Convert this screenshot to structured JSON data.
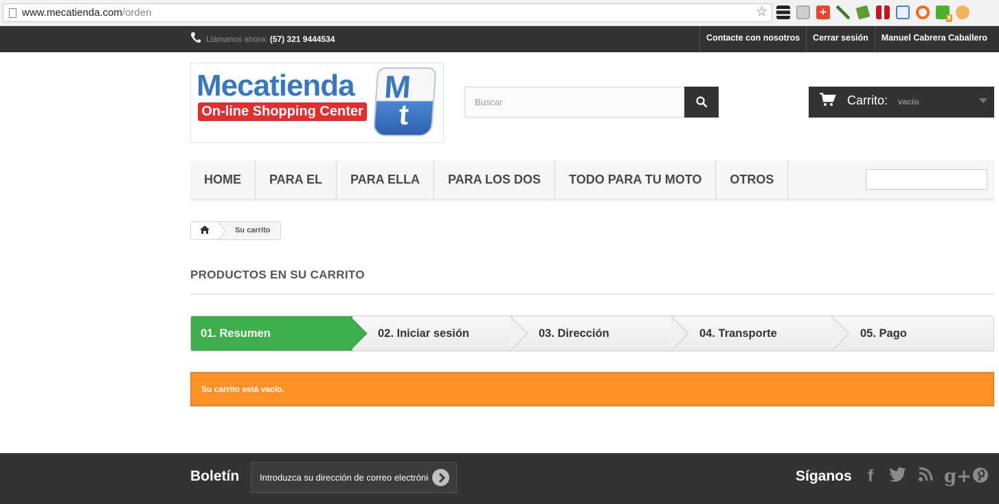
{
  "browser": {
    "url_host": "www.mecatienda.com",
    "url_path": "/orden",
    "icons": [
      "page-icon",
      "bookmark-star-icon",
      "layers-extension-icon",
      "extension-icon",
      "plus-extension-icon",
      "eyedropper-extension-icon",
      "stack-extension-icon",
      "pdf-extension-icon",
      "folder-extension-icon",
      "loop-extension-icon",
      "notification-extension-icon",
      "cookie-extension-icon"
    ],
    "notification_badge": "8"
  },
  "topbar": {
    "call_label": "Llámanos ahora: ",
    "phone": "(57) 321 9444534",
    "links": [
      "Contacte con nosotros",
      "Cerrar sesión",
      "Manuel Cabrera Caballero"
    ]
  },
  "logo": {
    "word": "Mecatienda",
    "tagline": "On-line Shopping Center",
    "mark_m": "M",
    "mark_t": "t"
  },
  "search": {
    "placeholder": "Buscar",
    "button_icon": "search-icon"
  },
  "cart": {
    "label": "Carrito:",
    "status": "vacío",
    "icon": "cart-icon"
  },
  "menu": {
    "items": [
      "HOME",
      "PARA EL",
      "PARA ELLA",
      "PARA LOS DOS",
      "TODO PARA TU MOTO",
      "OTROS"
    ]
  },
  "breadcrumb": {
    "home_icon": "home-icon",
    "current": "Su carrito"
  },
  "page": {
    "heading": "PRODUCTOS EN SU CARRITO"
  },
  "steps": [
    "01. Resumen",
    "02. Iniciar sesión",
    "03. Dirección",
    "04. Transporte",
    "05. Pago"
  ],
  "alert": {
    "message": "Su carrito está vacío."
  },
  "footer": {
    "newsletter_title": "Boletín",
    "newsletter_placeholder": "Introduzca su dirección de correo electrónico",
    "follow_title": "Síganos",
    "social": [
      "facebook-icon",
      "twitter-icon",
      "rss-icon",
      "google-plus-icon",
      "pinterest-icon"
    ]
  },
  "colors": {
    "dark": "#333333",
    "active_step": "#3eaf4c",
    "alert": "#fe9126",
    "logo_blue": "#3a78be",
    "logo_red": "#e22e2e"
  }
}
